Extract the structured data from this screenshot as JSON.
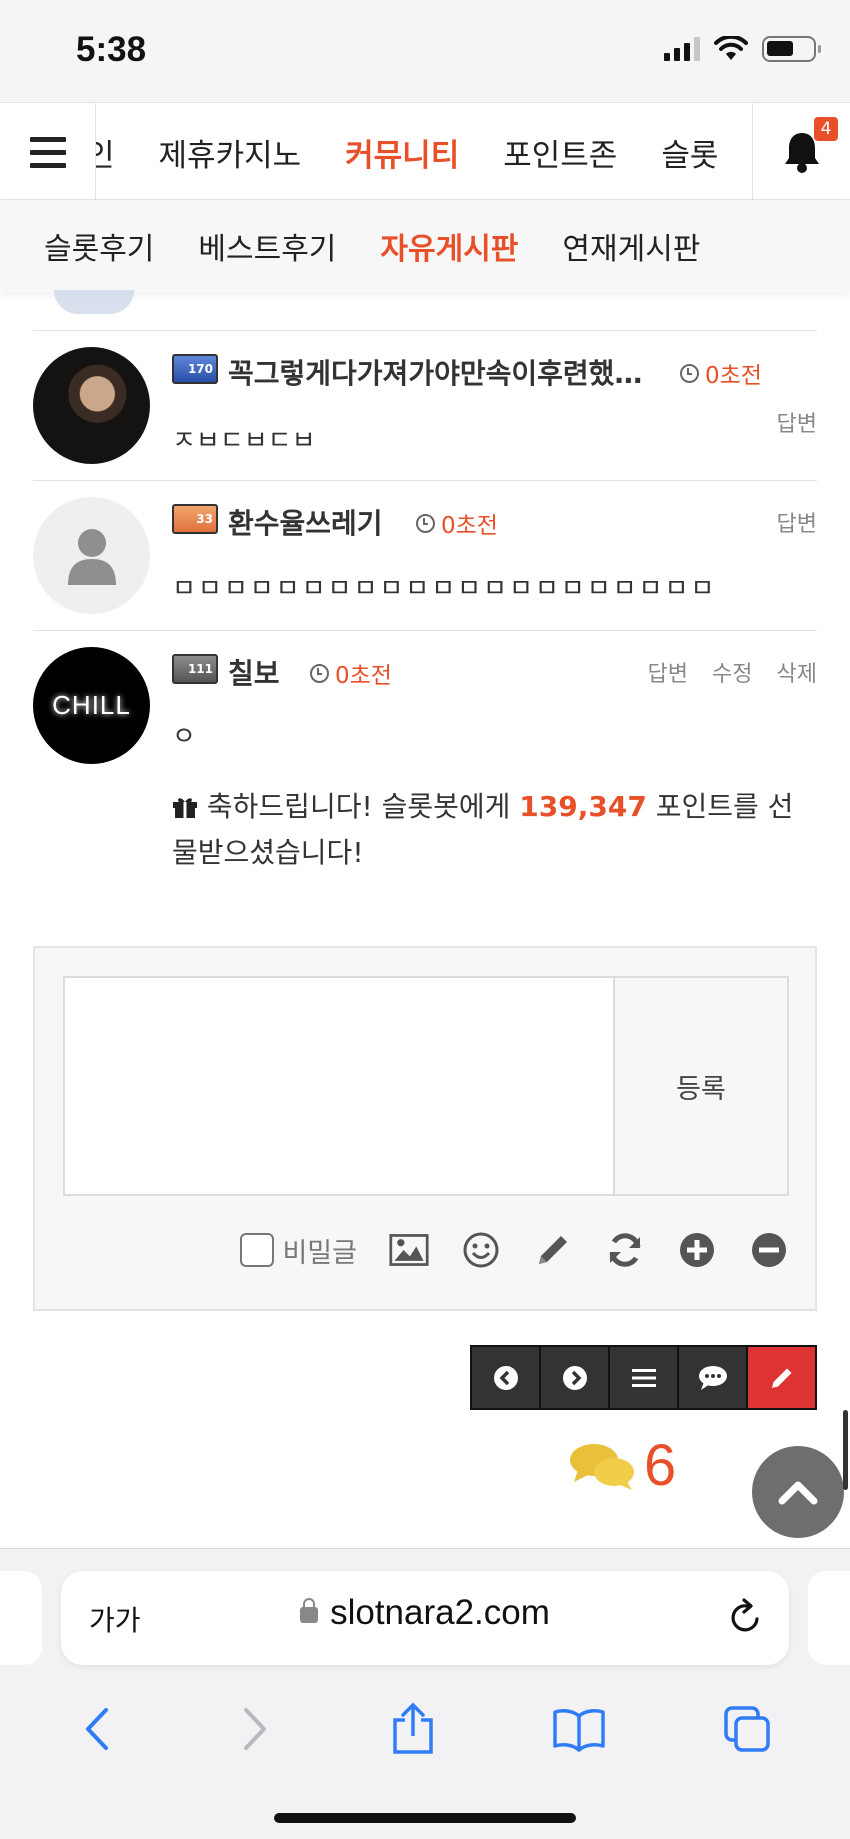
{
  "status_bar": {
    "time": "5:38"
  },
  "main_nav": {
    "items": [
      {
        "label": "인"
      },
      {
        "label": "제휴카지노"
      },
      {
        "label": "커뮤니티",
        "active": true
      },
      {
        "label": "포인트존"
      },
      {
        "label": "슬롯"
      }
    ],
    "notification_count": "4"
  },
  "sub_nav": {
    "items": [
      {
        "label": "슬롯후기"
      },
      {
        "label": "베스트후기"
      },
      {
        "label": "자유게시판",
        "active": true
      },
      {
        "label": "연재게시판"
      }
    ]
  },
  "comments": [
    {
      "name": "꼭그렇게다가져가야만속이후련했…",
      "level_badge": "170",
      "time": "0초전",
      "actions": [
        "답변"
      ],
      "body": "ㅈㅂㄷㅂㄷㅂ",
      "avatar": "photo"
    },
    {
      "name": "환수율쓰레기",
      "level_badge": "33",
      "time": "0초전",
      "actions": [
        "답변"
      ],
      "body": "ㅁㅁㅁㅁㅁㅁㅁㅁㅁㅁㅁㅁㅁㅁㅁㅁㅁㅁㅁㅁㅁ",
      "avatar": "default"
    },
    {
      "name": "칠보",
      "level_badge": "111",
      "time": "0초전",
      "actions": [
        "답변",
        "수정",
        "삭제"
      ],
      "body": "ㅇ",
      "avatar": "CHILL",
      "gift_prefix": "축하드립니다! 슬롯봇에게 ",
      "gift_points": "139,347",
      "gift_suffix": " 포인트를 선물받으셨습니다!"
    }
  ],
  "comment_form": {
    "submit_label": "등록",
    "secret_label": "비밀글",
    "tools": [
      "image-icon",
      "smile-icon",
      "pencil-icon",
      "refresh-icon",
      "plus-circle-icon",
      "minus-circle-icon"
    ]
  },
  "floating_bar": {
    "buttons": [
      "prev-icon",
      "next-icon",
      "list-icon",
      "comment-icon",
      "write-icon"
    ]
  },
  "comment_count": "6",
  "safari": {
    "text_size_label": "가가",
    "url": "slotnara2.com"
  },
  "colors": {
    "accent": "#e8502a",
    "write_button": "#dd3333",
    "ios_blue": "#2f7cf6"
  }
}
